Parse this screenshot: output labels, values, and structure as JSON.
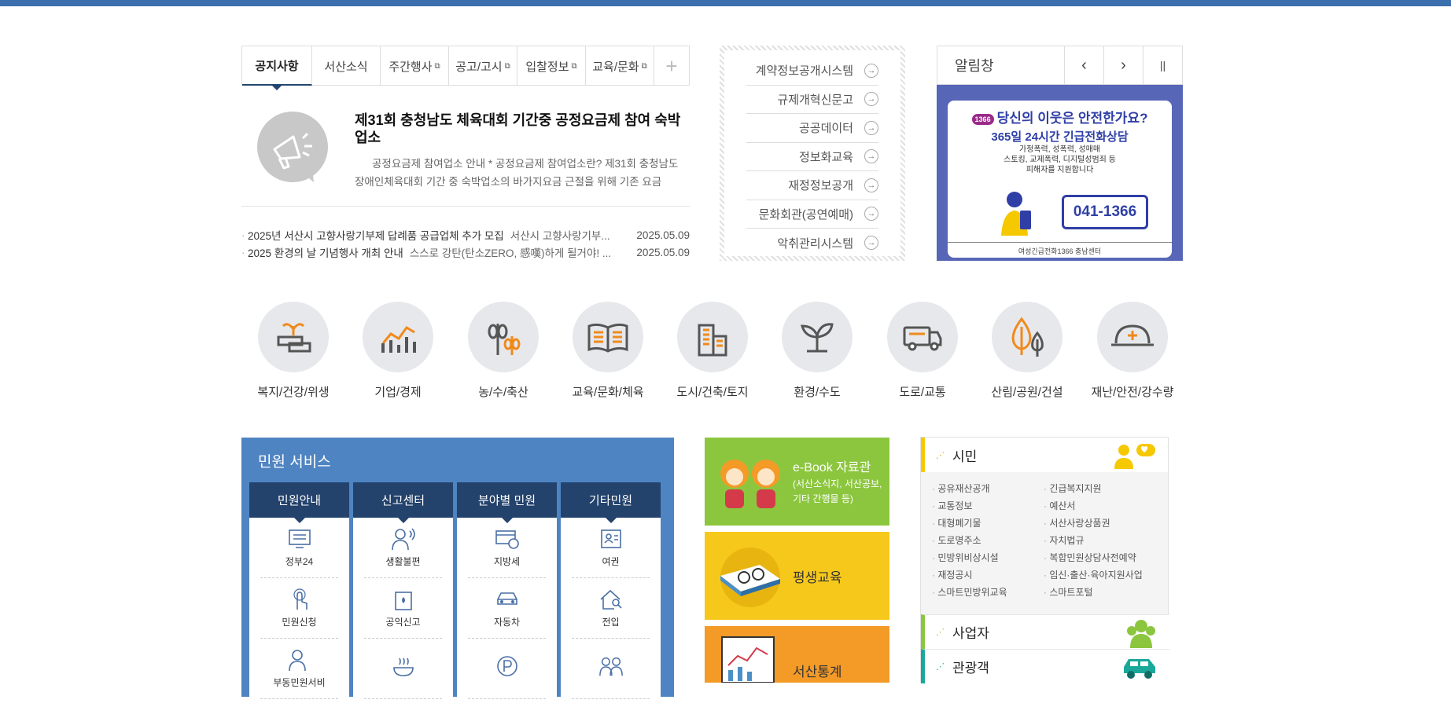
{
  "notice": {
    "tabs": [
      {
        "label": "공지사항",
        "ext": ""
      },
      {
        "label": "서산소식",
        "ext": ""
      },
      {
        "label": "주간행사",
        "ext": "⧉"
      },
      {
        "label": "공고/고시",
        "ext": "⧉"
      },
      {
        "label": "입찰정보",
        "ext": "⧉"
      },
      {
        "label": "교육/문화",
        "ext": "⧉"
      }
    ],
    "plus": "+",
    "featured_title": "제31회 충청남도 체육대회 기간중 공정요금제 참여 숙박업소",
    "featured_desc": "공정요금제 참여업소 안내 * 공정요금제 참여업소란? 제31회 충청남도 장애인체육대회 기간 중 숙박업소의 바가지요금 근절을 위해 기존 요금",
    "rows": [
      {
        "title": "2025년 서산시 고향사랑기부제 답례품 공급업체 추가 모집",
        "snippet": "서산시 고향사랑기부...",
        "date": "2025.05.09"
      },
      {
        "title": "2025 환경의 날 기념행사 개최 안내",
        "snippet": "스스로 강탄(탄소ZERO, 感嘆)하게 될거야! ...",
        "date": "2025.05.09"
      }
    ]
  },
  "links": {
    "items": [
      "계약정보공개시스템",
      "규제개혁신문고",
      "공공데이터",
      "정보화교육",
      "재정정보공개",
      "문화회관(공연예매)",
      "악취관리시스템"
    ],
    "arrow": "→"
  },
  "alert": {
    "title": "알림창",
    "prev": "‹",
    "next": "›",
    "pause": "||",
    "banner_heading": "당신의 이웃은 안전한가요?",
    "banner_sub": "365일 24시간 긴급전화상담",
    "banner_text1": "가정폭력, 성폭력, 성매매",
    "banner_text2": "스토킹, 교제폭력, 디지털성범죄 등",
    "banner_text3": "피해자를 지원합니다",
    "banner_badge": "1366",
    "banner_phone": "041-1366",
    "banner_footer": "여성긴급전화1366 충남센터"
  },
  "categories": [
    "복지/건강/위생",
    "기업/경제",
    "농/수/축산",
    "교육/문화/체육",
    "도시/건축/토지",
    "환경/수도",
    "도로/교통",
    "산림/공원/건설",
    "재난/안전/강수량"
  ],
  "minwon": {
    "title": "민원 서비스",
    "columns": [
      {
        "header": "민원안내",
        "items": [
          "정부24",
          "민원신청",
          "부동민원서비"
        ]
      },
      {
        "header": "신고센터",
        "items": [
          "생활불편",
          "공익신고",
          ""
        ]
      },
      {
        "header": "분야별 민원",
        "items": [
          "지방세",
          "자동차",
          ""
        ]
      },
      {
        "header": "기타민원",
        "items": [
          "여권",
          "전입",
          ""
        ]
      }
    ]
  },
  "banners": [
    {
      "title": "e-Book 자료관",
      "sub": "(서산소식지, 서산공보, 기타 간행물 등)",
      "color": "#8cc63f"
    },
    {
      "title": "평생교육",
      "sub": "",
      "color": "#f7c81c"
    },
    {
      "title": "서산통계",
      "sub": "",
      "color": "#f39a27"
    }
  ],
  "citizen": {
    "title": "시민",
    "items": [
      "공유재산공개",
      "긴급복지지원",
      "교통정보",
      "예산서",
      "대형폐기물",
      "서산사랑상품권",
      "도로명주소",
      "자치법규",
      "민방위비상시설",
      "복합민원상담사전예약",
      "재정공시",
      "임신·출산·육아지원사업",
      "스마트민방위교육",
      "스마트포털"
    ],
    "business": "사업자",
    "tourist": "관광객",
    "colors": {
      "citizen": "#f5c800",
      "business": "#8cc63f",
      "tourist": "#1aa89b"
    }
  }
}
